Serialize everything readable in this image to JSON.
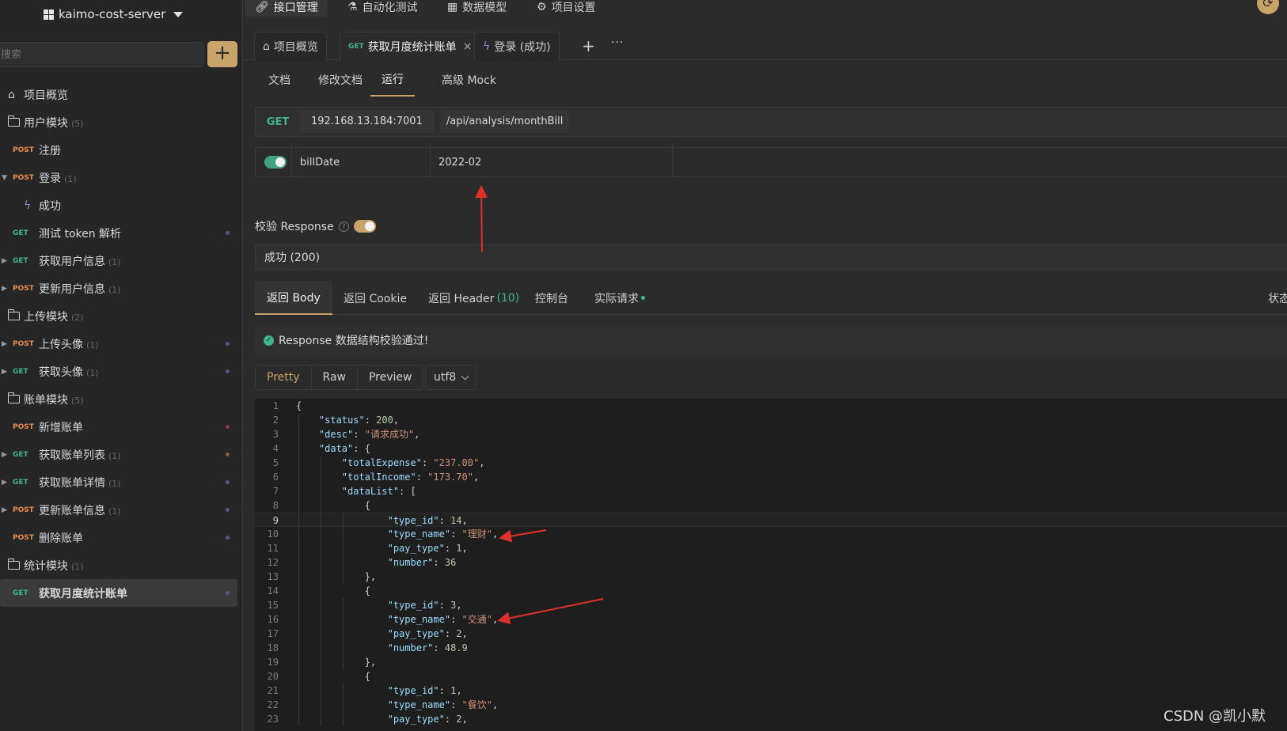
{
  "sidebar": {
    "project_name": "kaimo-cost-server",
    "search_placeholder": "搜索",
    "tree": [
      {
        "kind": "home",
        "label": "项目概览"
      },
      {
        "kind": "folder",
        "label": "用户模块",
        "count": "(5)"
      },
      {
        "kind": "api",
        "method": "POST",
        "label": "注册"
      },
      {
        "kind": "api",
        "method": "POST",
        "label": "登录",
        "count": "(1)",
        "expanded": true
      },
      {
        "kind": "case",
        "label": "成功"
      },
      {
        "kind": "api",
        "method": "GET",
        "label": "测试 token 解析",
        "dot": "#4a5a8a"
      },
      {
        "kind": "api",
        "method": "GET",
        "label": "获取用户信息",
        "count": "(1)",
        "collapsed": true
      },
      {
        "kind": "api",
        "method": "POST",
        "label": "更新用户信息",
        "count": "(1)",
        "collapsed": true
      },
      {
        "kind": "folder",
        "label": "上传模块",
        "count": "(2)"
      },
      {
        "kind": "api",
        "method": "POST",
        "label": "上传头像",
        "count": "(1)",
        "collapsed": true,
        "dot": "#4a5a8a"
      },
      {
        "kind": "api",
        "method": "GET",
        "label": "获取头像",
        "count": "(1)",
        "collapsed": true,
        "dot": "#4a5a8a"
      },
      {
        "kind": "folder",
        "label": "账单模块",
        "count": "(5)"
      },
      {
        "kind": "api",
        "method": "POST",
        "label": "新增账单",
        "dot": "#8a3a3a"
      },
      {
        "kind": "api",
        "method": "GET",
        "label": "获取账单列表",
        "count": "(1)",
        "collapsed": true,
        "dot": "#8a5a3a"
      },
      {
        "kind": "api",
        "method": "GET",
        "label": "获取账单详情",
        "count": "(1)",
        "collapsed": true,
        "dot": "#4a5a8a"
      },
      {
        "kind": "api",
        "method": "POST",
        "label": "更新账单信息",
        "count": "(1)",
        "collapsed": true,
        "dot": "#4a5a8a"
      },
      {
        "kind": "api",
        "method": "POST",
        "label": "删除账单",
        "dot": "#4a5a8a"
      },
      {
        "kind": "folder",
        "label": "统计模块",
        "count": "(1)"
      },
      {
        "kind": "api",
        "method": "GET",
        "label": "获取月度统计账单",
        "selected": true,
        "dot": "#4a5a8a"
      }
    ]
  },
  "topnav": {
    "items": [
      "接口管理",
      "自动化测试",
      "数据模型",
      "项目设置"
    ]
  },
  "tabs": {
    "overview": "项目概览",
    "active_method": "GET",
    "active": "获取月度统计账单",
    "case": "登录 (成功)"
  },
  "subtabs": [
    "文档",
    "修改文档",
    "运行",
    "高级 Mock"
  ],
  "request": {
    "method": "GET",
    "host": "192.168.13.184:7001",
    "path": "/api/analysis/monthBill",
    "param_name": "billDate",
    "param_value": "2022-02"
  },
  "validate": {
    "label": "校验 Response",
    "status": "成功 (200)"
  },
  "response_tabs": {
    "body": "返回 Body",
    "cookie": "返回 Cookie",
    "header": "返回 Header",
    "header_count": "(10)",
    "console": "控制台",
    "actual": "实际请求",
    "right": "状态"
  },
  "validation_message": "Response 数据结构校验通过!",
  "formats": [
    "Pretty",
    "Raw",
    "Preview"
  ],
  "encoding": "utf8",
  "code_lines": [
    "{",
    "    \"status\": 200,",
    "    \"desc\": \"请求成功\",",
    "    \"data\": {",
    "        \"totalExpense\": \"237.00\",",
    "        \"totalIncome\": \"173.70\",",
    "        \"dataList\": [",
    "            {",
    "                \"type_id\": 14,",
    "                \"type_name\": \"理财\",",
    "                \"pay_type\": 1,",
    "                \"number\": 36",
    "            },",
    "            {",
    "                \"type_id\": 3,",
    "                \"type_name\": \"交通\",",
    "                \"pay_type\": 2,",
    "                \"number\": 48.9",
    "            },",
    "            {",
    "                \"type_id\": 1,",
    "                \"type_name\": \"餐饮\",",
    "                \"pay_type\": 2,"
  ],
  "current_line": 9,
  "watermark": "CSDN @凯小默"
}
